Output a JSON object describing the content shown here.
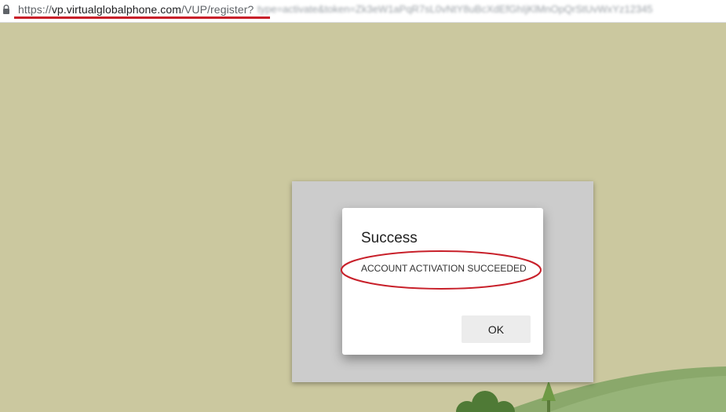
{
  "browser": {
    "url_secure_part": "https://",
    "url_host": "vp.virtualglobalphone.com",
    "url_path": "/VUP/register?",
    "url_trailing": "type=activate&token=Zk3eW1aPqR7sL0vNtY8uBcXdEfGhIjKlMnOpQrStUvWxYz12345"
  },
  "dialog": {
    "title": "Success",
    "message": "ACCOUNT ACTIVATION SUCCEEDED",
    "ok_label": "OK"
  },
  "colors": {
    "background": "#cbc89f",
    "annotation": "#c8202a",
    "hill": "#8aa86b",
    "tree": "#4f7a36"
  },
  "icons": {
    "lock": "lock-icon"
  }
}
